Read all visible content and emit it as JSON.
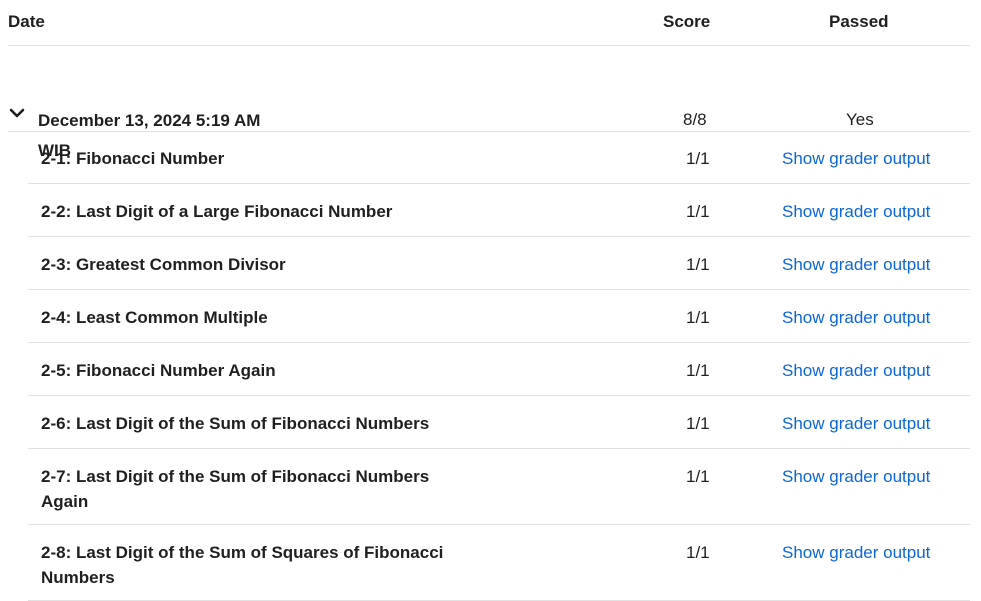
{
  "header": {
    "date": "Date",
    "score": "Score",
    "passed": "Passed"
  },
  "attempt": {
    "date": "December 13, 2024 5:19 AM WIB",
    "score": "8/8",
    "passed": "Yes",
    "icon": "chevron-down-icon"
  },
  "rows": [
    {
      "title": "2-1: Fibonacci Number",
      "score": "1/1",
      "link": "Show grader output"
    },
    {
      "title": "2-2: Last Digit of a Large Fibonacci Number",
      "score": "1/1",
      "link": "Show grader output"
    },
    {
      "title": "2-3: Greatest Common Divisor",
      "score": "1/1",
      "link": "Show grader output"
    },
    {
      "title": "2-4: Least Common Multiple",
      "score": "1/1",
      "link": "Show grader output"
    },
    {
      "title": "2-5: Fibonacci Number Again",
      "score": "1/1",
      "link": "Show grader output"
    },
    {
      "title": "2-6: Last Digit of the Sum of Fibonacci Numbers",
      "score": "1/1",
      "link": "Show grader output"
    },
    {
      "title": "2-7: Last Digit of the Sum of Fibonacci Numbers Again",
      "score": "1/1",
      "link": "Show grader output"
    },
    {
      "title": "2-8: Last Digit of the Sum of Squares of Fibonacci Numbers",
      "score": "1/1",
      "link": "Show grader output"
    }
  ],
  "colors": {
    "link": "#0b66d6",
    "divider": "#e1e1e1",
    "text": "#1f1f1f"
  }
}
